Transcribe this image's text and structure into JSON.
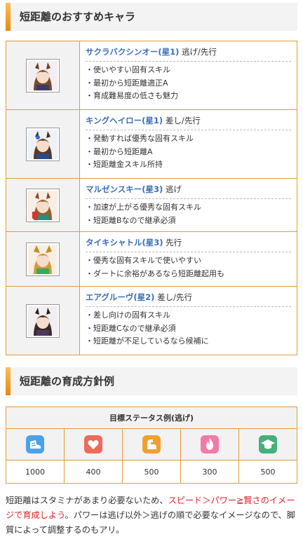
{
  "section1": {
    "title": "短距離のおすすめキャラ",
    "characters": [
      {
        "name": "サクラバクシンオー(星1)",
        "style": "逃げ/先行",
        "avatar_icon": "character-portrait-icon",
        "points": [
          "・使いやすい固有スキル",
          "・最初から短距離適正A",
          "・育成難易度の低さも魅力"
        ]
      },
      {
        "name": "キングヘイロー(星1)",
        "style": "差し/先行",
        "avatar_icon": "character-portrait-icon",
        "points": [
          "・発動すれば優秀な固有スキル",
          "・最初から短距離A",
          "・短距離金スキル所持"
        ]
      },
      {
        "name": "マルゼンスキー(星3)",
        "style": "逃げ",
        "avatar_icon": "character-portrait-icon",
        "points": [
          "・加速が上がる優秀な固有スキル",
          "・短距離Bなので継承必須"
        ]
      },
      {
        "name": "タイキシャトル(星3)",
        "style": "先行",
        "avatar_icon": "character-portrait-icon",
        "points": [
          "・優秀な固有スキルで使いやすい",
          "・ダートに余裕があるなら短距離起用も"
        ]
      },
      {
        "name": "エアグルーヴ(星2)",
        "style": "差し/先行",
        "avatar_icon": "character-portrait-icon",
        "points": [
          "・差し向けの固有スキル",
          "・短距離Cなので継承必須",
          "・短距離が不足しているなら候補に"
        ]
      }
    ]
  },
  "section2": {
    "title": "短距離の育成方針例",
    "table_header": "目標ステータス例(逃げ)",
    "stats": [
      {
        "icon": "speed-shoe-icon",
        "color": "#4aa3e8",
        "value": "1000"
      },
      {
        "icon": "stamina-heart-icon",
        "color": "#ee6a5a",
        "value": "400"
      },
      {
        "icon": "power-arm-icon",
        "color": "#f0a030",
        "value": "500"
      },
      {
        "icon": "guts-flame-icon",
        "color": "#f07aa8",
        "value": "300"
      },
      {
        "icon": "wisdom-cap-icon",
        "color": "#44b07a",
        "value": "500"
      }
    ]
  },
  "paragraph": {
    "part1": "短距離はスタミナがあまり必要ないため、",
    "highlight": "スピード＞パワー≧賢さのイメージで育成しよう",
    "part2": "。パワーは逃げ以外＞逃げの順で必要なイメージなので、脚質によって調整するのもアリ。"
  },
  "colors": {
    "accent": "#e39a36",
    "link": "#3a6fb7",
    "highlight": "#e0242a"
  }
}
